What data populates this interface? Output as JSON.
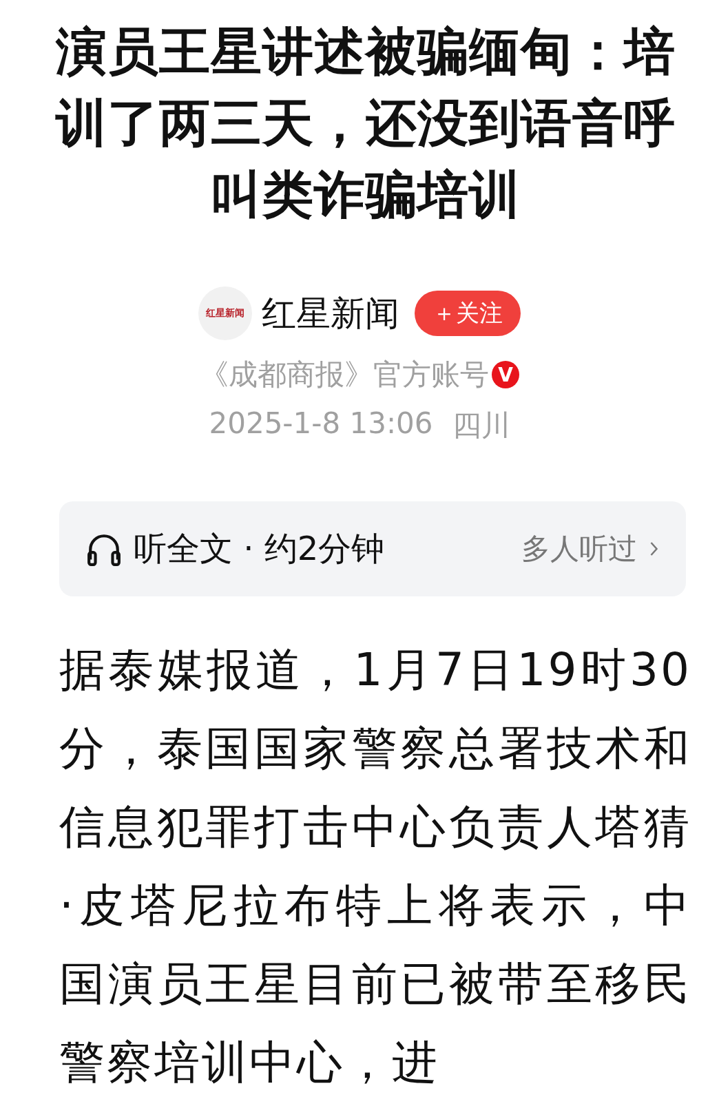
{
  "article": {
    "title": "演员王星讲述被骗缅甸：培训了两三天，还没到语音呼叫类诈骗培训",
    "source": {
      "logo_text": "红星新闻",
      "name": "红星新闻",
      "follow_label": "＋关注",
      "account": "《成都商报》官方账号",
      "verified_badge": "V",
      "verified": true,
      "datetime": "2025-1-8  13:06",
      "location": "四川"
    },
    "audio": {
      "label": "听全文 · 约2分钟",
      "listeners": "多人听过"
    },
    "body": "据泰媒报道，1月7日19时30分，泰国国家警察总署技术和信息犯罪打击中心负责人塔猜·皮塔尼拉布特上将表示，中国演员王星目前已被带至移民警察培训中心，进"
  }
}
